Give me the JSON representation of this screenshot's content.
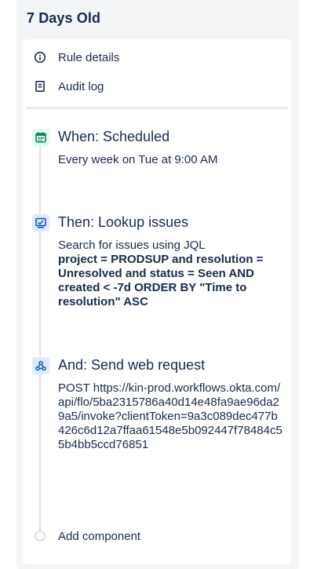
{
  "panel": {
    "title": "7 Days Old"
  },
  "menu": {
    "items": [
      {
        "label": "Rule details",
        "icon": "info-icon"
      },
      {
        "label": "Audit log",
        "icon": "document-icon"
      }
    ]
  },
  "steps": [
    {
      "icon": "calendar-icon",
      "title": "When: Scheduled",
      "text": "Every week on Tue at 9:00 AM"
    },
    {
      "icon": "lookup-screen-icon",
      "title": "Then: Lookup issues",
      "text": "Search for issues using JQL",
      "query": "project = PRODSUP and resolution = Unresolved and status = Seen AND created < -7d ORDER BY \"Time to resolution\" ASC"
    },
    {
      "icon": "webhook-icon",
      "title": "And: Send web request",
      "text": "POST https://kin-prod.workflows.okta.com/api/flo/5ba2315786a40d14e48fa9ae96da29a5/invoke?clientToken=9a3c089dec477b426c6d12a7ffaa61548e5b092447f78484c55b4bb5ccd76851"
    }
  ],
  "add_component": {
    "label": "Add component"
  },
  "colors": {
    "panel_bg": "#f4f5f7",
    "text": "#172b4d",
    "trigger_bg": "#e3fcef",
    "trigger_fg": "#00875a",
    "action_bg": "#deebff",
    "action_fg": "#0052cc"
  }
}
